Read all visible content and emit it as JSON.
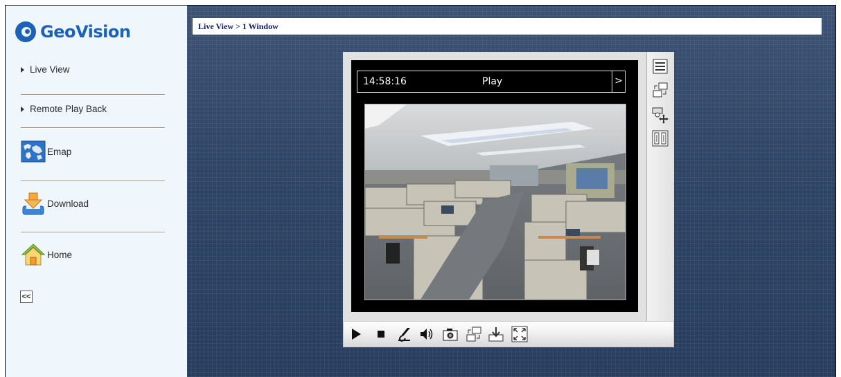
{
  "brand": {
    "name": "GeoVision"
  },
  "breadcrumb": "Live View > 1 Window",
  "sidebar": {
    "items": [
      {
        "label": "Live View",
        "icon": "triangle-bullet-icon"
      },
      {
        "label": "Remote Play Back",
        "icon": "triangle-bullet-icon"
      },
      {
        "label": "Emap",
        "icon": "world-map-icon"
      },
      {
        "label": "Download",
        "icon": "download-icon"
      },
      {
        "label": "Home",
        "icon": "home-icon"
      }
    ],
    "collapse_label": "<<"
  },
  "viewer": {
    "time": "14:58:16",
    "mode": "Play",
    "next_label": ">"
  },
  "side_toolbar": [
    "list-menu-icon",
    "switch-channel-icon",
    "ptz-control-icon",
    "io-control-icon"
  ],
  "bottom_toolbar": [
    "play-icon",
    "stop-icon",
    "microphone-icon",
    "speaker-icon",
    "snapshot-icon",
    "switch-stream-icon",
    "save-icon",
    "fullscreen-icon"
  ],
  "colors": {
    "brand": "#1b62b8",
    "sidebar_bg": "#eff6fc",
    "main_bg": "#2f4566",
    "breadcrumb_text": "#0c1c5c"
  }
}
